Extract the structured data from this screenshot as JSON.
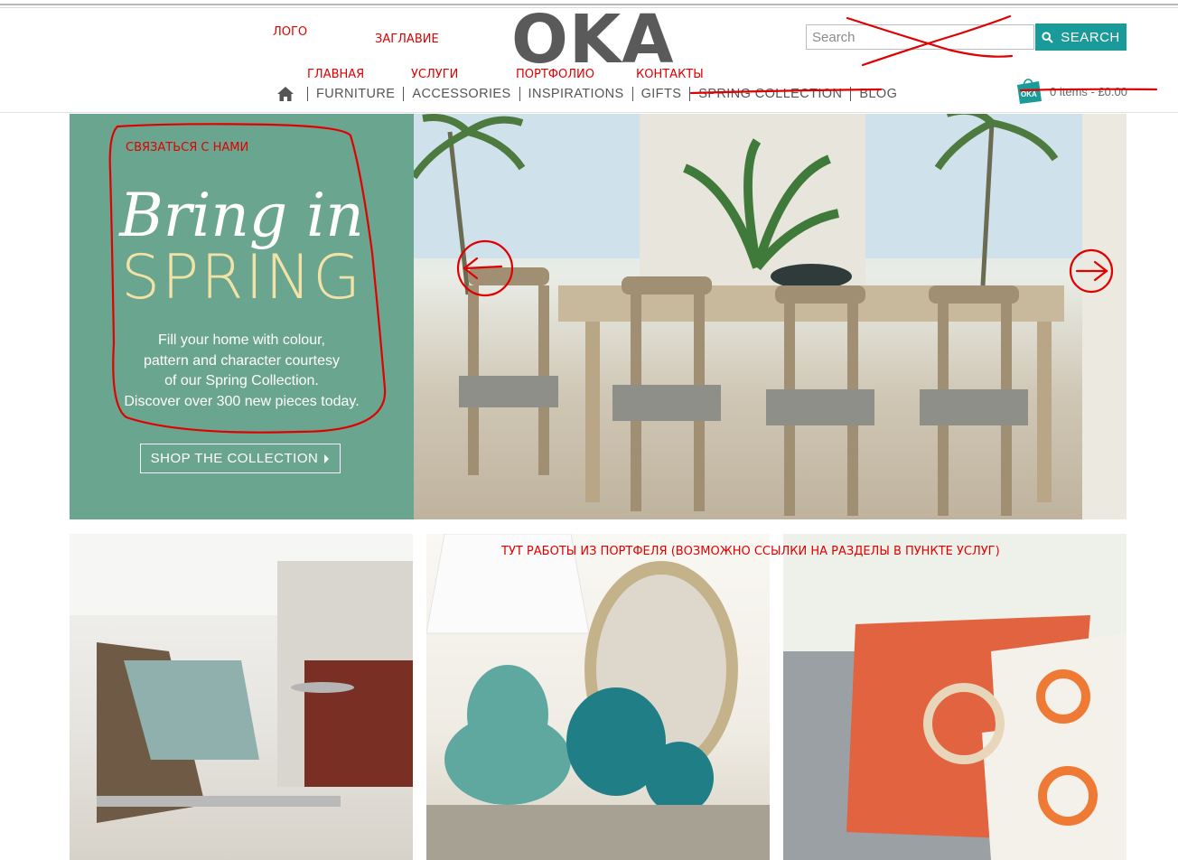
{
  "annotations": {
    "logo_note": "ЛОГО",
    "title_note": "ЗАГЛАВИЕ",
    "nav_notes": [
      "ГЛАВНАЯ",
      "УСЛУГИ",
      "ПОРТФОЛИО",
      "КОНТАКТЫ"
    ],
    "contact_note": "СВЯЗАТЬСЯ С НАМИ",
    "portfolio_note": "ТУТ РАБОТЫ ИЗ ПОРТФЕЛЯ (ВОЗМОЖНО ССЫЛКИ НА РАЗДЕЛЫ В ПУНКТЕ УСЛУГ)"
  },
  "header": {
    "logo_text": "OKA",
    "search": {
      "placeholder": "Search",
      "button_label": "SEARCH"
    },
    "nav": [
      "FURNITURE",
      "ACCESSORIES",
      "INSPIRATIONS",
      "GIFTS",
      "SPRING COLLECTION",
      "BLOG"
    ],
    "cart": {
      "badge": "OKA",
      "text": "0 items - £0.00"
    }
  },
  "hero": {
    "title_line1": "Bring in",
    "title_line2": "SPRING",
    "copy": [
      "Fill your home with colour,",
      "pattern and character courtesy",
      "of our Spring Collection.",
      "Discover over 300 new pieces today."
    ],
    "cta_label": "SHOP THE COLLECTION"
  },
  "colors": {
    "accent": "#1b9a9a",
    "hero_panel": "#6aa58f",
    "annotation_red": "#e00000"
  }
}
